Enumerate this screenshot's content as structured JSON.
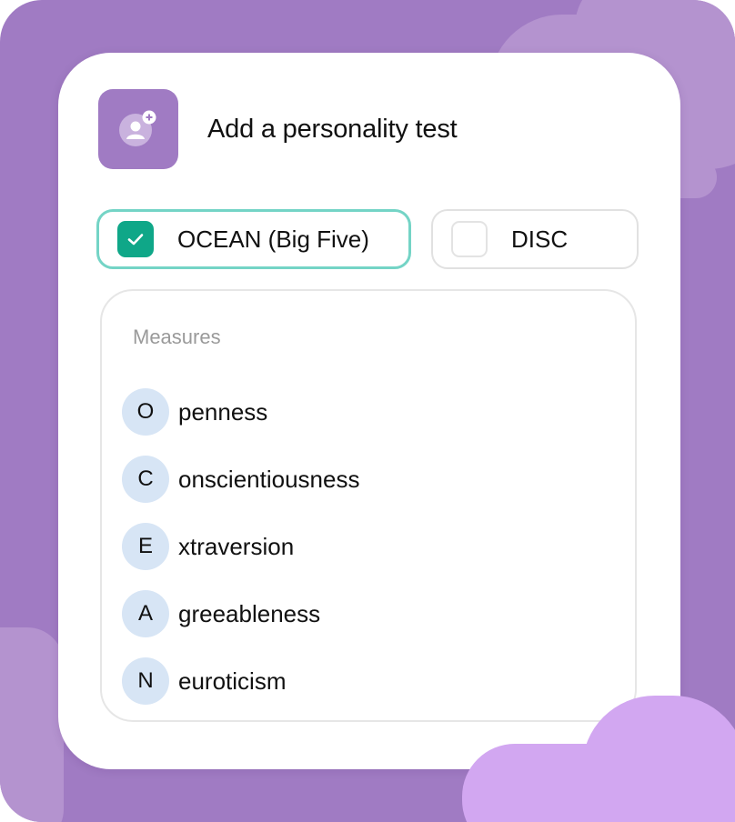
{
  "header": {
    "title": "Add a personality test",
    "icon": "add-user-icon"
  },
  "options": [
    {
      "label": "OCEAN (Big Five)",
      "checked": true
    },
    {
      "label": "DISC",
      "checked": false
    }
  ],
  "measures": {
    "heading": "Measures",
    "items": [
      {
        "letter": "O",
        "rest": "penness"
      },
      {
        "letter": "C",
        "rest": "onscientiousness"
      },
      {
        "letter": "E",
        "rest": "xtraversion"
      },
      {
        "letter": "A",
        "rest": "greeableness"
      },
      {
        "letter": "N",
        "rest": "euroticism"
      }
    ]
  },
  "colors": {
    "background": "#a07bc3",
    "accent_check": "#0fa788",
    "selected_border": "#74d4c6",
    "badge": "#d7e5f5"
  }
}
